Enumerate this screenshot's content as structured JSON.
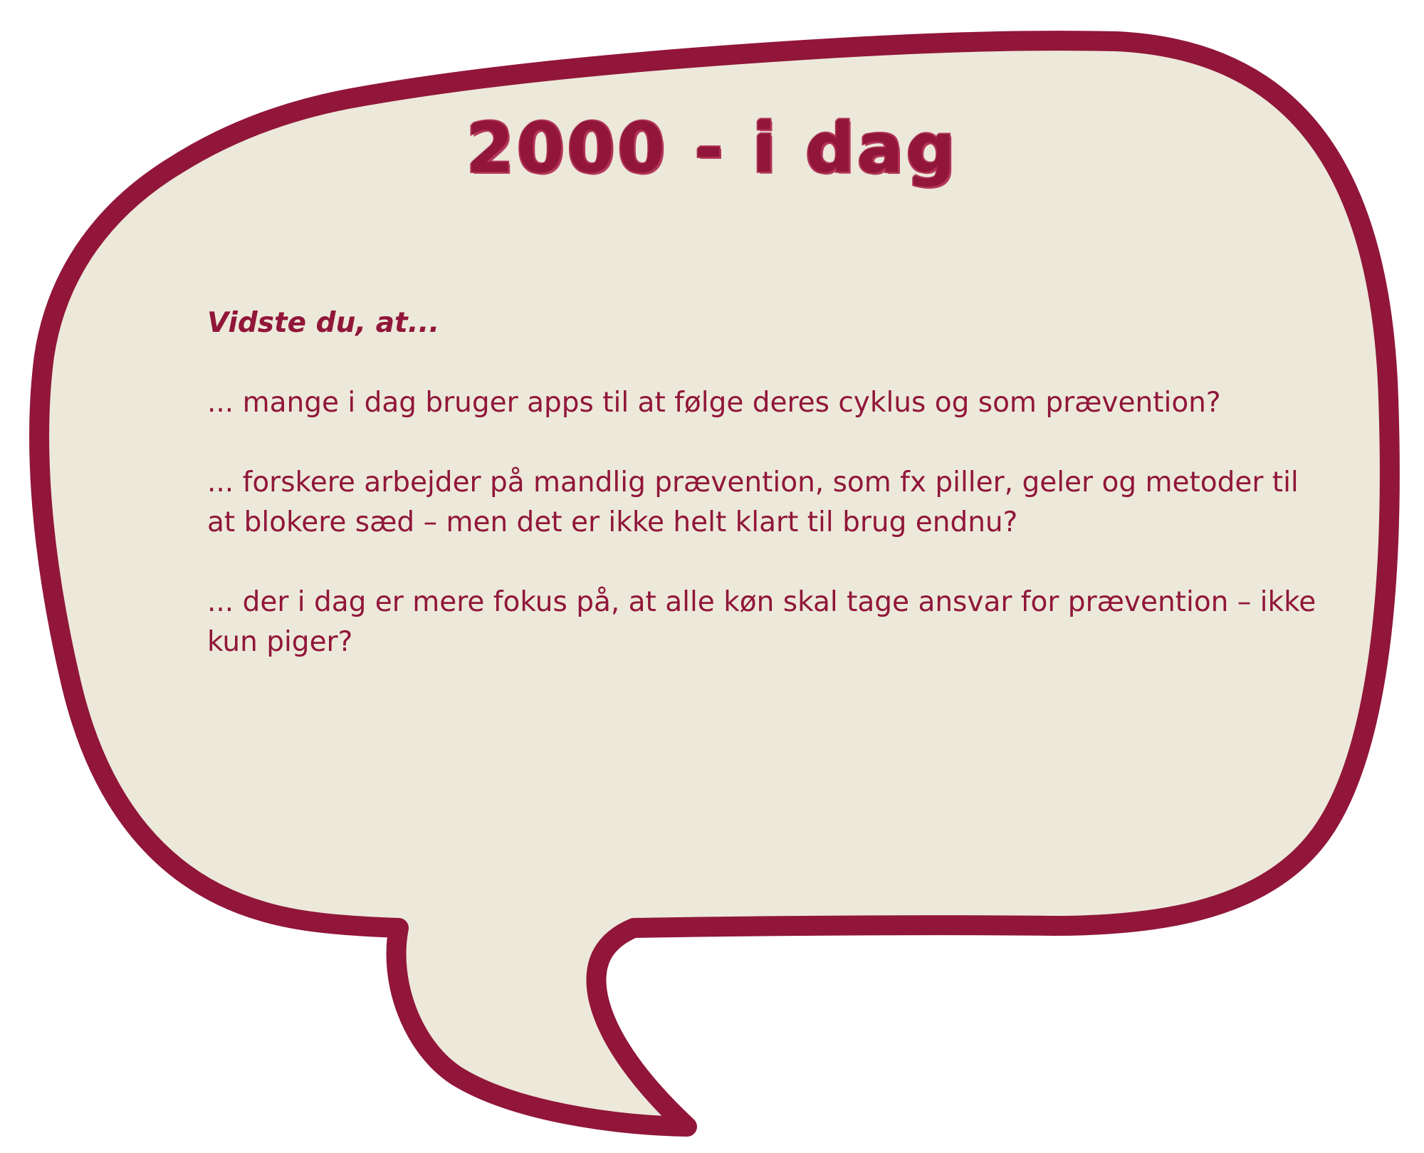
{
  "title": "2000 - i dag",
  "lead": "Vidste du, at...",
  "facts": [
    "... mange i dag bruger apps til at følge deres cyklus og som prævention?",
    "... forskere arbejder på mandlig prævention, som fx piller, geler og metoder til at blokere sæd – men det er ikke helt klart til brug endnu?",
    "... der i dag er mere fokus på, at alle køn skal tage ansvar for prævention – ikke kun piger?"
  ],
  "colors": {
    "accent": "#91163a",
    "bubble_fill": "#ece9da",
    "background": "#ffffff"
  }
}
